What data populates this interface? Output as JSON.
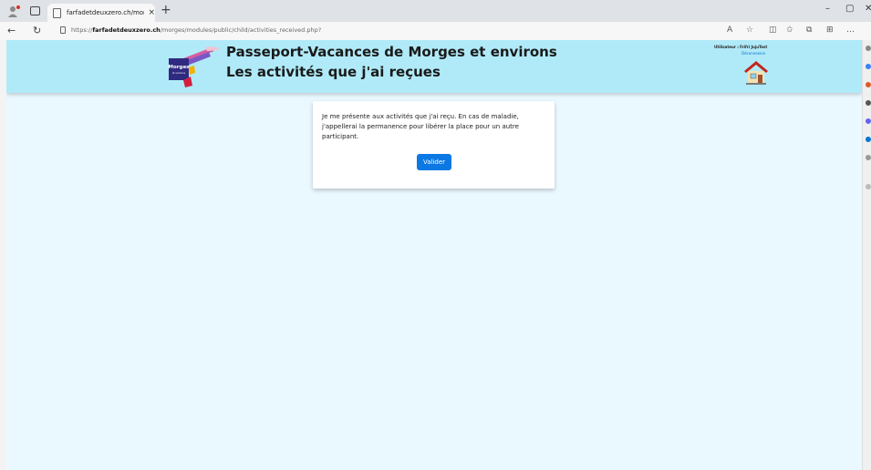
{
  "browser": {
    "tab_title": "farfadetdeuxzero.ch/morges/mo",
    "tab_close": "×",
    "new_tab": "+",
    "url_prefix": "https://",
    "url_domain": "farfadetdeuxzero.ch",
    "url_path": "/morges/modules/public/child/activities_received.php?",
    "minimize": "–",
    "restore": "▢",
    "close": "✕",
    "icons": [
      "profile-icon",
      "tab-switcher-icon",
      "back-icon",
      "refresh-icon",
      "lock-icon",
      "read-aloud-icon",
      "favorite-icon",
      "split-screen-icon",
      "favorites-icon",
      "collections-icon",
      "extensions-icon",
      "more-icon"
    ]
  },
  "header": {
    "title_line1": "Passeport-Vacances de Morges et environs",
    "title_line2": "Les activités que j'ai reçues",
    "user_label": "Utilisateur : Frifri JujuTest",
    "logout_label": "Déconnexion",
    "logo_text": "Morges",
    "logo_subtext": "et environs"
  },
  "card": {
    "message": "Je me présente aux activités que j'ai reçu. En cas de maladie, j'appellerai la permanence pour libérer la place pour un autre participant.",
    "button_label": "Valider"
  },
  "colors": {
    "header_bg": "#b0eaf8",
    "page_bg": "#eaf8ff",
    "button_bg": "#0b78e3"
  }
}
